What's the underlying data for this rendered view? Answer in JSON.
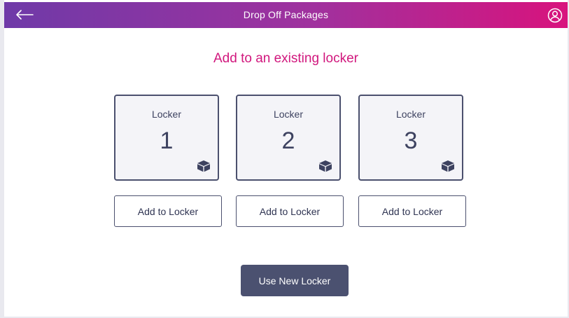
{
  "header": {
    "title": "Drop Off Packages",
    "back_icon": "arrow-left-icon",
    "account_icon": "user-circle-icon",
    "gradient_colors": [
      "#6f3aa8",
      "#a0319e",
      "#d8137d"
    ]
  },
  "main": {
    "heading": "Add to an existing locker",
    "heading_color": "#d1177d",
    "lockers": [
      {
        "label": "Locker",
        "number": "1",
        "icon": "package-icon",
        "button_label": "Add to Locker"
      },
      {
        "label": "Locker",
        "number": "2",
        "icon": "package-icon",
        "button_label": "Add to Locker"
      },
      {
        "label": "Locker",
        "number": "3",
        "icon": "package-icon",
        "button_label": "Add to Locker"
      }
    ],
    "new_locker_button": "Use New Locker",
    "primary_button_color": "#4b5170"
  }
}
